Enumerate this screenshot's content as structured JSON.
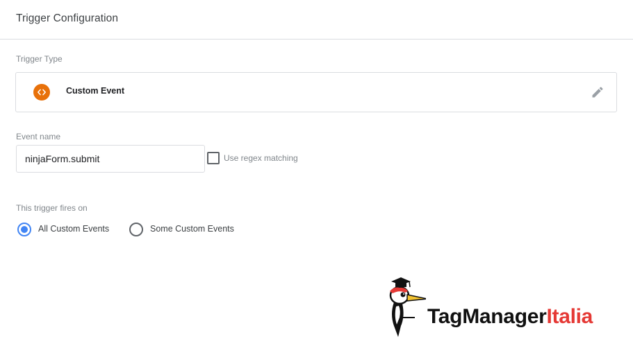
{
  "panel": {
    "title": "Trigger Configuration"
  },
  "trigger_type": {
    "label": "Trigger Type",
    "name": "Custom Event",
    "icon": "custom-event-code-icon",
    "icon_color": "#e8710a"
  },
  "event_name": {
    "label": "Event name",
    "value": "ninjaForm.submit",
    "regex_checkbox": {
      "label": "Use regex matching",
      "checked": false
    }
  },
  "fires_on": {
    "label": "This trigger fires on",
    "options": [
      {
        "label": "All Custom Events",
        "selected": true
      },
      {
        "label": "Some Custom Events",
        "selected": false
      }
    ],
    "accent_color": "#4285f4"
  },
  "watermark": {
    "text_part1": "TagManager",
    "text_part2": "Italia",
    "part2_color": "#e53935"
  }
}
